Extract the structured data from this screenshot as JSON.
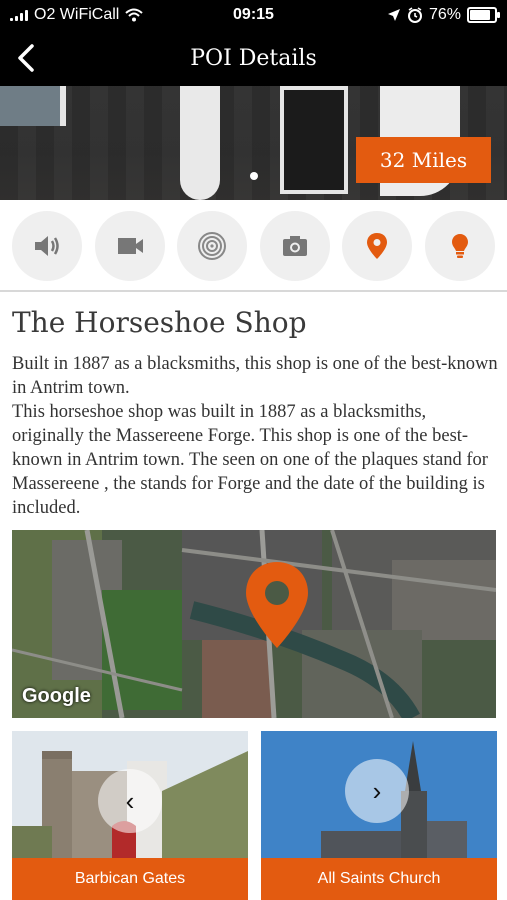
{
  "status_bar": {
    "carrier": "O2 WiFiCall",
    "time": "09:15",
    "battery": "76%",
    "battery_level": 0.76
  },
  "nav": {
    "title": "POI Details",
    "back_icon": "chevron-left-icon"
  },
  "hero": {
    "distance": "32 Miles"
  },
  "actions": [
    {
      "icon": "speaker-icon"
    },
    {
      "icon": "video-camera-icon"
    },
    {
      "icon": "radar-target-icon"
    },
    {
      "icon": "camera-icon"
    },
    {
      "icon": "map-pin-icon",
      "active": true
    },
    {
      "icon": "lightbulb-icon",
      "active": true
    }
  ],
  "poi": {
    "title": "The Horseshoe Shop",
    "description": "Built in 1887 as a blacksmiths, this shop is one of the best-known in Antrim town.\nThis horseshoe shop was built in 1887 as a blacksmiths, originally the Massereene Forge. This shop is one of the best-known in Antrim town. The seen on one of the plaques stand for Massereene , the stands for  Forge and the date of the building is included."
  },
  "map": {
    "attribution": "Google"
  },
  "nearby": [
    {
      "label": "Barbican Gates",
      "arrow": "‹"
    },
    {
      "label": "All Saints Church",
      "arrow": "›"
    }
  ],
  "colors": {
    "accent": "#e35b10",
    "header": "#000000",
    "action_bg": "#efefef"
  }
}
